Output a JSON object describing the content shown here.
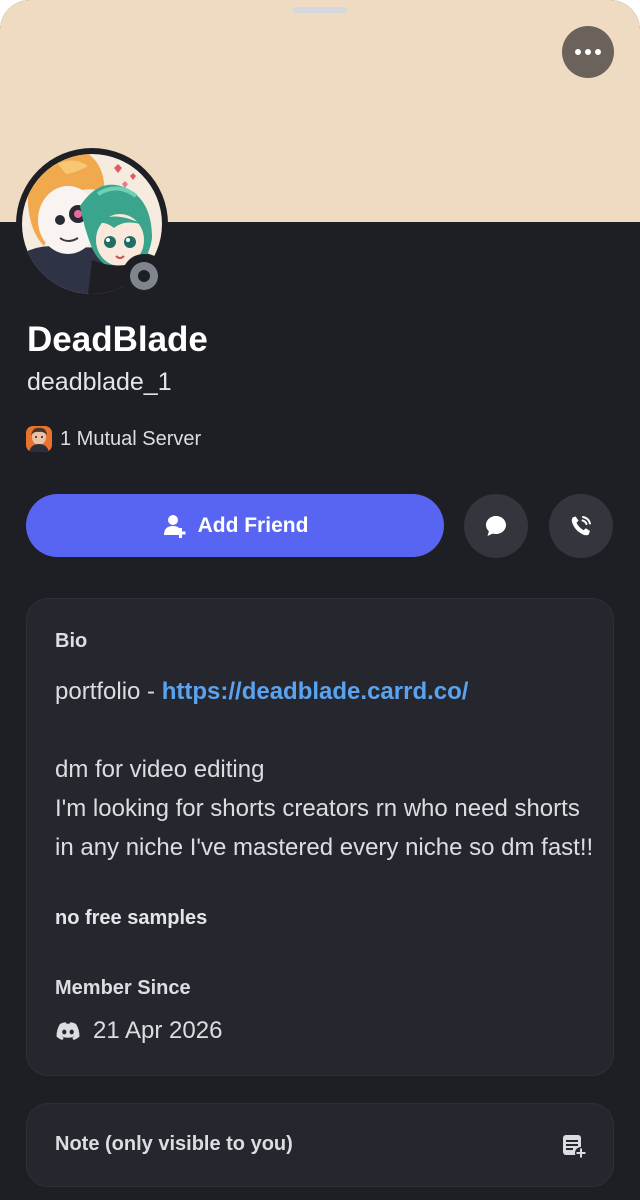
{
  "profile": {
    "display_name": "DeadBlade",
    "username": "deadblade_1",
    "status": "offline",
    "mutual_servers": "1 Mutual Server",
    "banner_color": "#efdbc1"
  },
  "actions": {
    "add_friend_label": "Add Friend",
    "message_icon": "chat-bubble-icon",
    "call_icon": "phone-call-icon",
    "more_icon": "more-horizontal-icon"
  },
  "bio": {
    "label": "Bio",
    "portfolio_prefix": "portfolio - ",
    "portfolio_link": "https://deadblade.carrd.co/",
    "line_video": "dm for video editing",
    "line_looking": "I'm looking for shorts creators rn who need shorts in any niche I've mastered every niche so dm fast!!",
    "line_samples": "no free samples"
  },
  "member_since": {
    "label": "Member Since",
    "icon": "discord-icon",
    "date": "21 Apr 2026"
  },
  "note": {
    "label": "Note (only visible to you)",
    "icon": "add-note-icon"
  },
  "colors": {
    "accent": "#5865f2",
    "link": "#5aa3f0",
    "background": "#1e1f24",
    "card": "#26272e"
  }
}
